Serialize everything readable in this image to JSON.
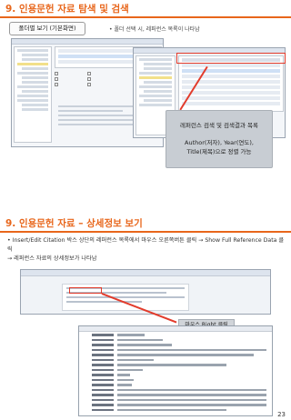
{
  "slide1": {
    "title": "9. 인용문헌 자료 탐색 및 검색",
    "folder_view_label": "폴더별 보기 (기본화면)",
    "folder_hint": "• 폴더 선택 시, 레퍼런스 목록이 나타남",
    "callout_line1": "레퍼런스 검색 및 검색결과 목록",
    "callout_line2": "Author(저자), Year(연도),",
    "callout_line3": "Title(제목)으로 정렬 가능"
  },
  "slide2": {
    "title": "9. 인용문헌 자료 – 상세정보 보기",
    "desc_line1": "• Insert/Edit Citation 박스 상단의 레퍼런스 목록에서 마우스 오른쪽버튼 클릭 → Show Full Reference Data 클릭",
    "desc_line2": "→ 레퍼런스 자료의 상세정보가 나타남",
    "right_click_label": "마우스 Right 클릭",
    "page_number": "23"
  },
  "colors": {
    "accent": "#e8661b",
    "arrow": "#e23b2b",
    "callout_bg": "#c8cdd3"
  }
}
